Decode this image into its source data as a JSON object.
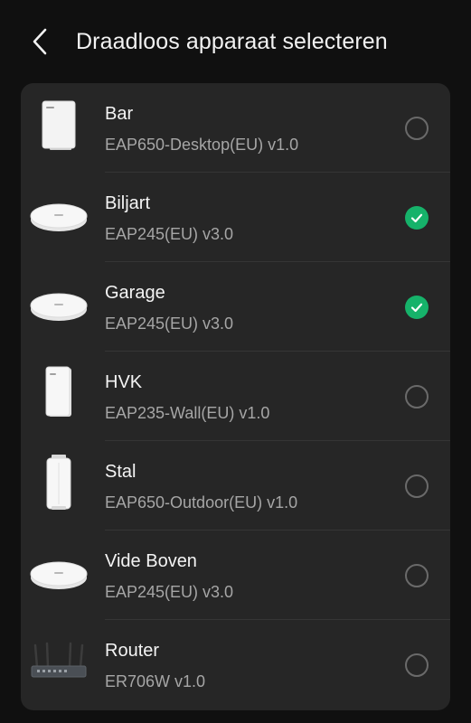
{
  "header": {
    "title": "Draadloos apparaat selecteren",
    "back_icon": "chevron-left-icon"
  },
  "colors": {
    "background": "#101010",
    "card": "#262626",
    "accent_checked": "#16b26a",
    "radio_unchecked": "#6a6a6a"
  },
  "devices": [
    {
      "name": "Bar",
      "model": "EAP650-Desktop(EU) v1.0",
      "icon": "desktop-access-point-icon",
      "selected": false
    },
    {
      "name": "Biljart",
      "model": "EAP245(EU) v3.0",
      "icon": "ceiling-access-point-icon",
      "selected": true
    },
    {
      "name": "Garage",
      "model": "EAP245(EU) v3.0",
      "icon": "ceiling-access-point-icon",
      "selected": true
    },
    {
      "name": "HVK",
      "model": "EAP235-Wall(EU) v1.0",
      "icon": "wall-access-point-icon",
      "selected": false
    },
    {
      "name": "Stal",
      "model": "EAP650-Outdoor(EU) v1.0",
      "icon": "outdoor-access-point-icon",
      "selected": false
    },
    {
      "name": "Vide Boven",
      "model": "EAP245(EU) v3.0",
      "icon": "ceiling-access-point-icon",
      "selected": false
    },
    {
      "name": "Router",
      "model": "ER706W v1.0",
      "icon": "router-icon",
      "selected": false
    }
  ]
}
